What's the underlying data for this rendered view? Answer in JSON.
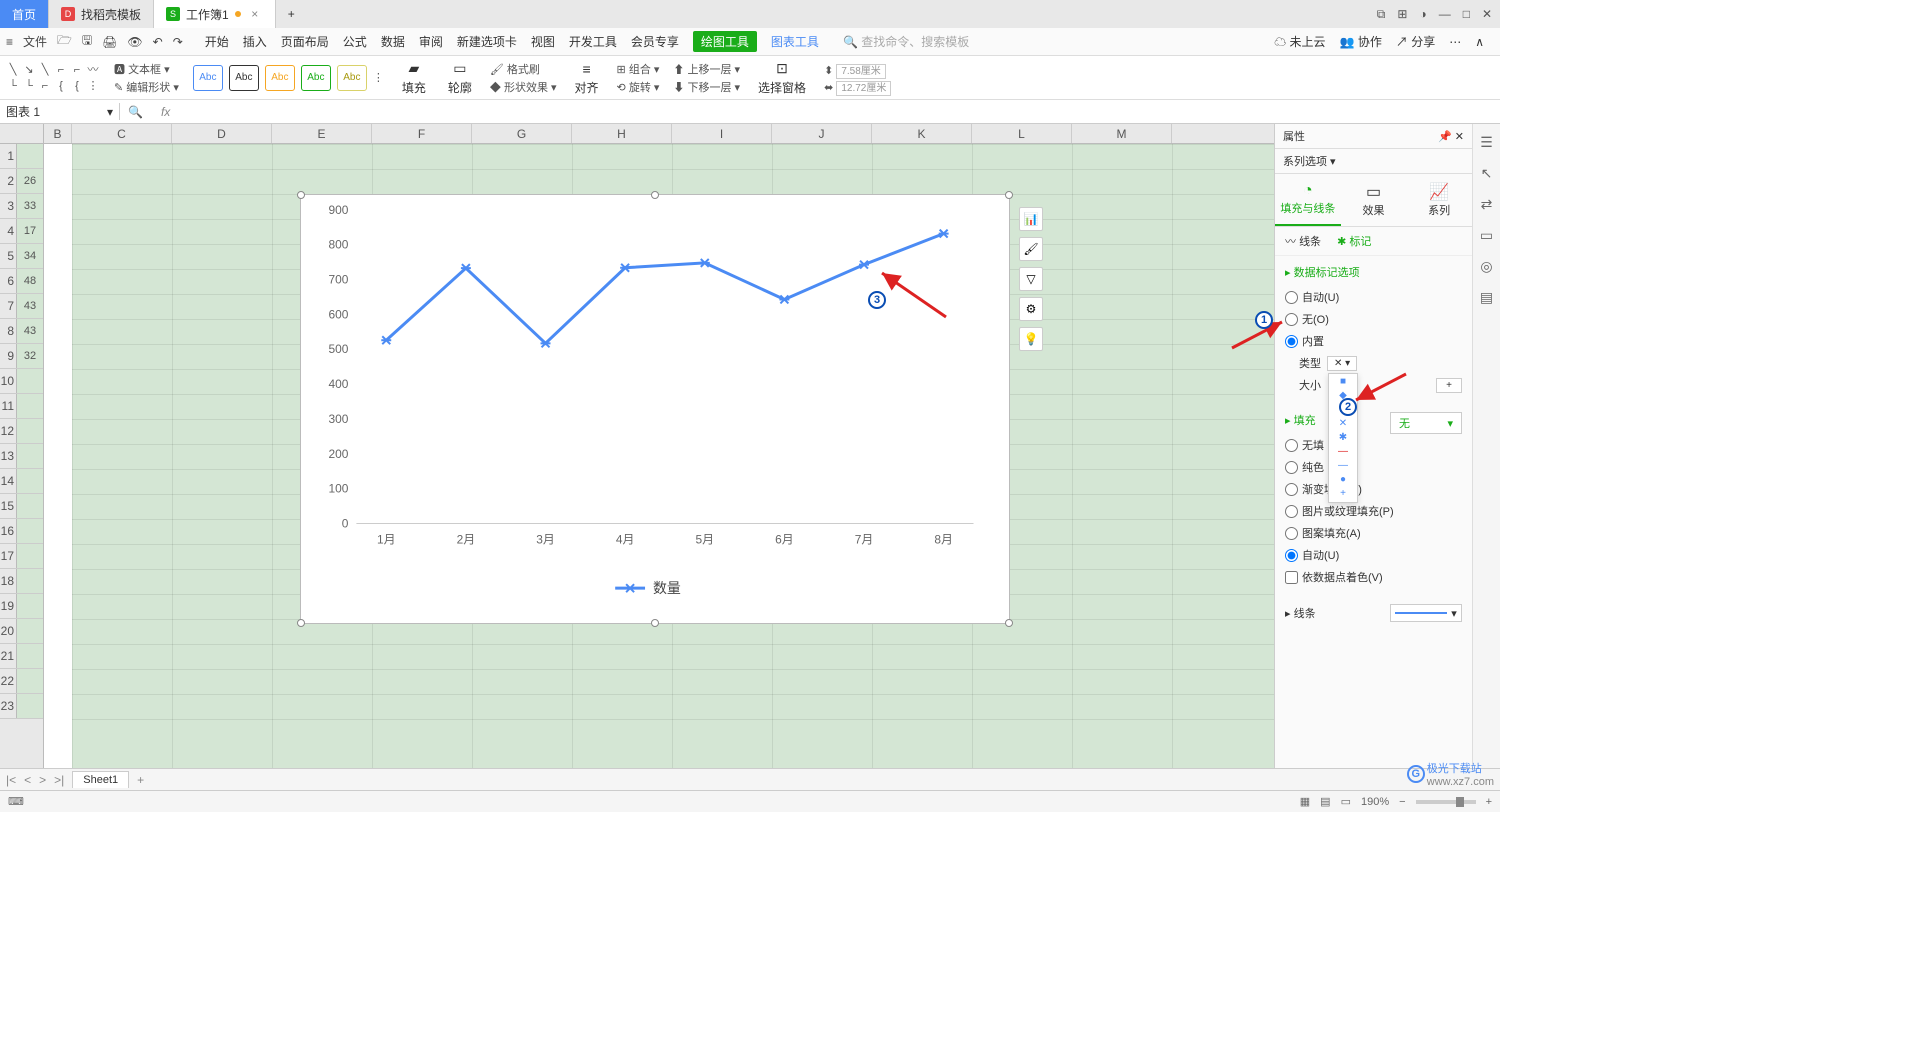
{
  "titlebar": {
    "home": "首页",
    "template_tab": "找稻壳模板",
    "workbook_tab": "工作簿1",
    "add": "+"
  },
  "winbtns": {
    "a": "⧉",
    "b": "⊞",
    "avatar": "◑",
    "min": "—",
    "max": "□",
    "close": "✕"
  },
  "menubar": {
    "file": "文件",
    "items": [
      "开始",
      "插入",
      "页面布局",
      "公式",
      "数据",
      "审阅",
      "新建选项卡",
      "视图",
      "开发工具",
      "会员专享"
    ],
    "draw_tool": "绘图工具",
    "chart_tool": "图表工具",
    "search_ph": "查找命令、搜索模板",
    "cloud": "未上云",
    "coop": "协作",
    "share": "分享"
  },
  "ribbon": {
    "textbox": "文本框",
    "editshape": "编辑形状",
    "fill": "填充",
    "outline": "轮廓",
    "effect": "形状效果",
    "fmtbrush": "格式刷",
    "align": "对齐",
    "group": "组合",
    "rotate": "旋转",
    "up": "上移一层",
    "down": "下移一层",
    "selpane": "选择窗格",
    "w": "7.58厘米",
    "h": "12.72厘米"
  },
  "namebox": "图表 1",
  "cols": [
    "B",
    "C",
    "D",
    "E",
    "F",
    "G",
    "H",
    "I",
    "J",
    "K",
    "L",
    "M"
  ],
  "rows": [
    1,
    2,
    3,
    4,
    5,
    6,
    7,
    8,
    9,
    10,
    11,
    12,
    13,
    14,
    15,
    16,
    17,
    18,
    19,
    20,
    21,
    22,
    23
  ],
  "cellB": [
    "",
    "26",
    "33",
    "17",
    "34",
    "48",
    "43",
    "43",
    "32"
  ],
  "chart_data": {
    "type": "line",
    "categories": [
      "1月",
      "2月",
      "3月",
      "4月",
      "5月",
      "6月",
      "7月",
      "8月"
    ],
    "series": [
      {
        "name": "数量",
        "values": [
          526,
          733,
          517,
          734,
          748,
          643,
          743,
          832
        ]
      }
    ],
    "xlabel": "",
    "ylabel": "",
    "ylim": [
      0,
      900
    ],
    "yticks": [
      0,
      100,
      200,
      300,
      400,
      500,
      600,
      700,
      800,
      900
    ],
    "legend": "数量"
  },
  "panel": {
    "title": "属性",
    "series_opts": "系列选项",
    "tab_fill": "填充与线条",
    "tab_effect": "效果",
    "tab_series": "系列",
    "sub_line": "线条",
    "sub_marker": "标记",
    "marker_opts": "数据标记选项",
    "auto": "自动(U)",
    "none_o": "无(O)",
    "builtin": "内置",
    "type": "类型",
    "size": "大小",
    "plus": "+",
    "fill_title": "填充",
    "fill_none": "无",
    "no_fill": "无填",
    "solid": "纯色",
    "grad": "渐变填充(G)",
    "pic": "图片或纹理填充(P)",
    "pattern": "图案填充(A)",
    "autofill": "自动(U)",
    "byPoint": "依数据点着色(V)",
    "line_title": "线条"
  },
  "sheettab": "Sheet1",
  "status": {
    "zoom": "190%"
  },
  "anno": {
    "one": "1",
    "two": "2",
    "three": "3"
  },
  "watermark": {
    "brand": "极光下载站",
    "url": "www.xz7.com"
  }
}
